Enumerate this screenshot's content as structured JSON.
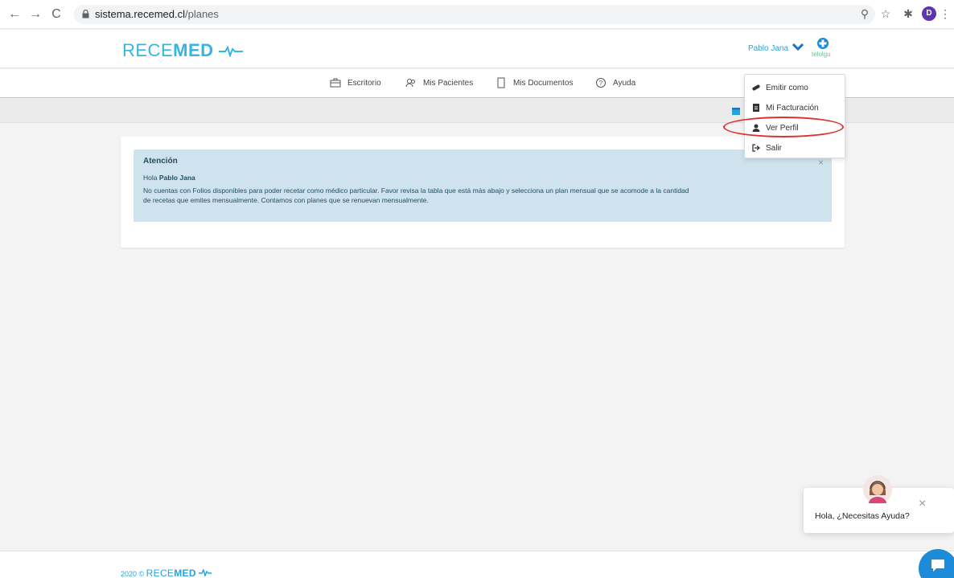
{
  "browser": {
    "url_host": "sistema.recemed.cl",
    "url_path": "/planes",
    "profile_initial": "D",
    "back_icon": "←",
    "forward_icon": "→",
    "reload_icon": "C",
    "zoom_icon": "⚲",
    "star_icon": "☆",
    "extensions_icon": "✱",
    "menu_icon": "⋮"
  },
  "header": {
    "logo_light": "RECE",
    "logo_bold": "MED",
    "user_name": "Pablo Jana"
  },
  "nav": {
    "items": [
      {
        "label": "Escritorio",
        "icon": "briefcase-icon"
      },
      {
        "label": "Mis Pacientes",
        "icon": "users-icon"
      },
      {
        "label": "Mis Documentos",
        "icon": "document-icon"
      },
      {
        "label": "Ayuda",
        "icon": "help-icon"
      }
    ]
  },
  "alert": {
    "title": "Atención",
    "greeting_prefix": "Hola",
    "greeting_name": "Pablo Jana",
    "message_line1": "No cuentas con Folios disponibles para poder recetar como médico particular. Favor revisa la tabla que está más abajo y selecciona un plan mensual que se acomode a la cantidad",
    "message_line2": "de recetas que emites mensualmente. Contamos con planes que se renuevan mensualmente.",
    "close": "×"
  },
  "dropdown": {
    "items": [
      {
        "label": "Emitir como",
        "icon": "pills-icon"
      },
      {
        "label": "Mi Facturación",
        "icon": "invoice-icon"
      },
      {
        "label": "Ver Perfil",
        "icon": "user-icon"
      },
      {
        "label": "Salir",
        "icon": "sign-out-icon"
      }
    ]
  },
  "footer": {
    "year": "2020 ©",
    "logo_light": "RECE",
    "logo_bold": "MED"
  },
  "help": {
    "text": "Hola, ¿Necesitas Ayuda?",
    "close": "×"
  },
  "colors": {
    "accent": "#29a3db",
    "alert_bg": "#cfe3ee",
    "highlight": "#e03030",
    "chat": "#1d8bd8"
  }
}
